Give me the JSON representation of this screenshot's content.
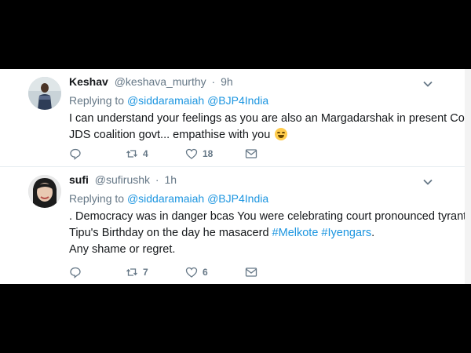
{
  "tweets": [
    {
      "display_name": "Keshav",
      "handle": "@keshava_murthy",
      "time": "9h",
      "replying_label": "Replying to",
      "mentions": [
        "@siddaramaiah",
        "@BJP4India"
      ],
      "text_lines": [
        "I can understand your feelings as you are also an Margadarshak in present Cong-",
        "JDS coalition govt... empathise with you"
      ],
      "emoji": "face-with-tears-of-joy",
      "replies": "",
      "retweets": "4",
      "likes": "18"
    },
    {
      "display_name": "sufi",
      "handle": "@sufirushk",
      "time": "1h",
      "replying_label": "Replying to",
      "mentions": [
        "@siddaramaiah",
        "@BJP4India"
      ],
      "text_lines": [
        ". Democracy was in danger bcas You were celebrating court pronounced tyrant",
        "Tipu's Birthday on the day he masacerd",
        "Any shame or regret."
      ],
      "hashtags": [
        "#Melkote",
        "#Iyengars"
      ],
      "replies": "",
      "retweets": "7",
      "likes": "6"
    }
  ],
  "icons": {
    "more": "chevron-down-icon",
    "reply": "reply-icon",
    "retweet": "retweet-icon",
    "like": "heart-icon",
    "message": "envelope-icon"
  },
  "colors": {
    "link": "#1b95e0",
    "text": "#14171a",
    "muted": "#657786",
    "background": "#ffffff",
    "frame": "#000000"
  }
}
